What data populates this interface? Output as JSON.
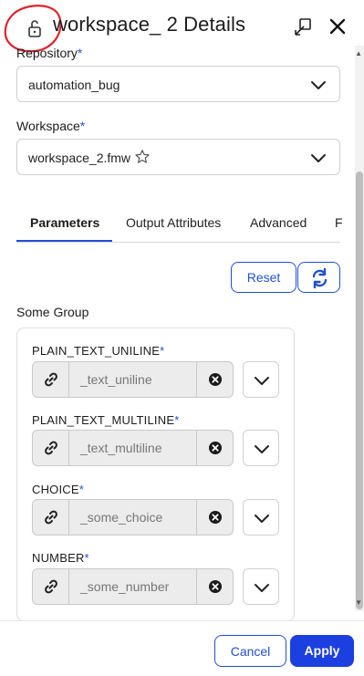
{
  "header": {
    "title": "workspace_ 2 Details",
    "lock_icon": "lock-icon",
    "popout_icon": "popout-icon",
    "close_icon": "close-icon",
    "annotation_color": "#e0232b"
  },
  "repository": {
    "label": "Repository",
    "required_mark": "*",
    "value": "automation_bug"
  },
  "workspace": {
    "label": "Workspace",
    "required_mark": "*",
    "value": "workspace_2.fmw"
  },
  "tabs": [
    {
      "label": "Parameters",
      "active": true
    },
    {
      "label": "Output Attributes",
      "active": false
    },
    {
      "label": "Advanced",
      "active": false
    },
    {
      "label": "F",
      "active": false
    }
  ],
  "actions": {
    "reset_label": "Reset",
    "refresh_icon": "refresh-icon"
  },
  "group": {
    "title": "Some Group",
    "params": [
      {
        "label": "PLAIN_TEXT_UNILINE",
        "required_mark": "*",
        "placeholder": "_text_uniline"
      },
      {
        "label": "PLAIN_TEXT_MULTILINE",
        "required_mark": "*",
        "placeholder": "_text_multiline"
      },
      {
        "label": "CHOICE",
        "required_mark": "*",
        "placeholder": "_some_choice"
      },
      {
        "label": "NUMBER",
        "required_mark": "*",
        "placeholder": "_some_number"
      }
    ]
  },
  "footer": {
    "cancel_label": "Cancel",
    "apply_label": "Apply"
  },
  "colors": {
    "accent": "#1f4fd6",
    "primary_button": "#1c3fe0"
  }
}
